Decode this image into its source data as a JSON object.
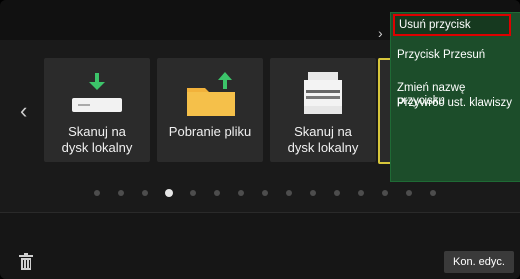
{
  "tiles": [
    {
      "label": "Skanuj na\ndysk lokalny",
      "icon": "scan-to-local-drive-icon"
    },
    {
      "label": "Pobranie pliku",
      "icon": "file-download-folder-icon"
    },
    {
      "label": "Skanuj na\ndysk lokalny",
      "icon": "printer-scan-icon"
    }
  ],
  "menu": {
    "items": [
      "Usuń przycisk",
      "Przycisk Przesuń",
      "Zmień nazwę\nprzycisku",
      "Przywróć ust. klawiszy"
    ]
  },
  "footer": {
    "end_edit_label": "Kon. edyc."
  },
  "pagination": {
    "total": 15,
    "active_index": 3
  }
}
